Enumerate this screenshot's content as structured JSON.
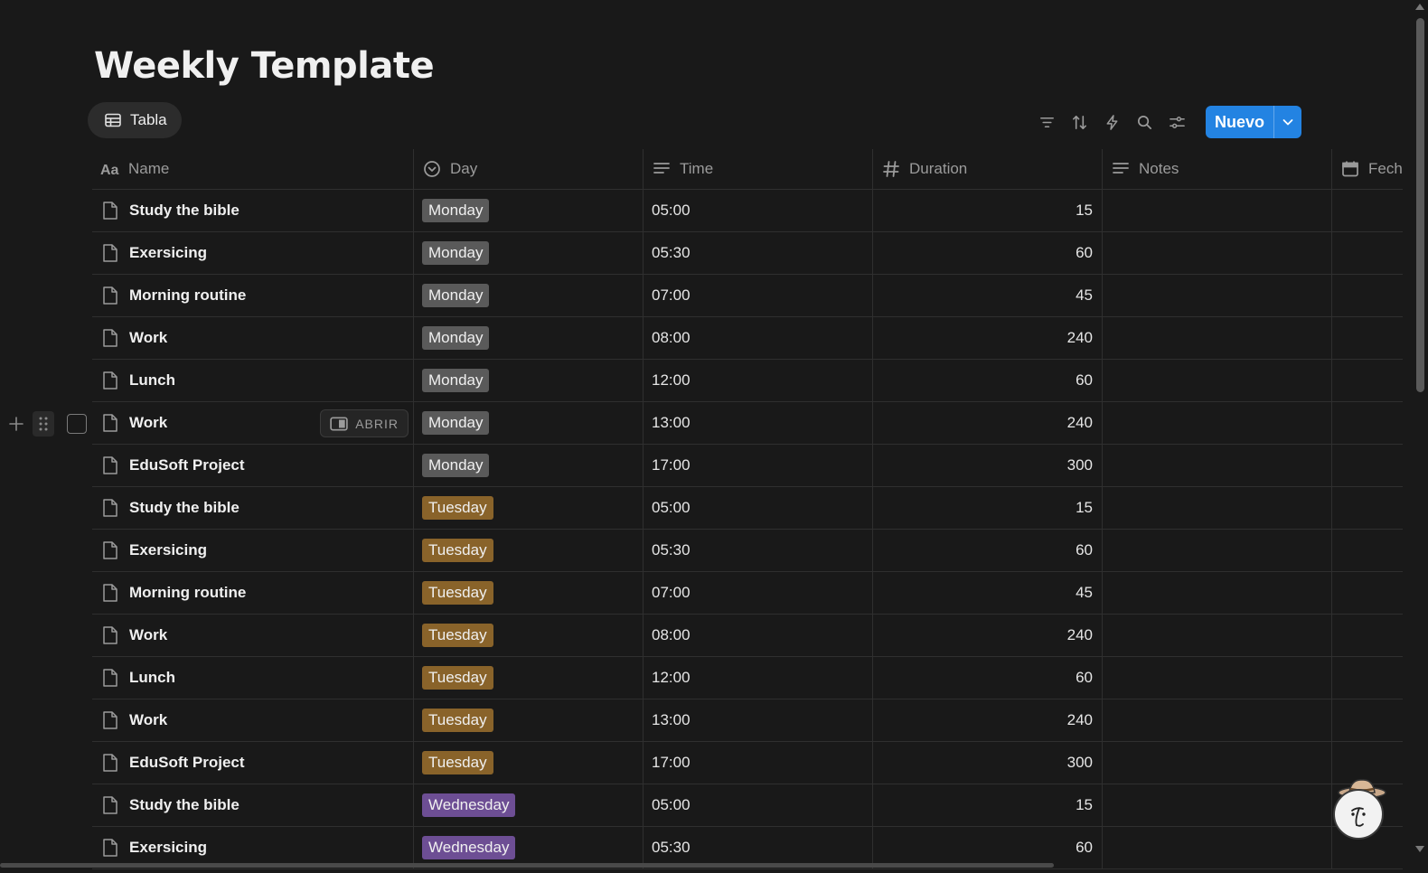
{
  "page": {
    "title": "Weekly Template"
  },
  "view_tab": {
    "label": "Tabla",
    "icon": "table-icon"
  },
  "toolbar": {
    "icons": [
      "filter-icon",
      "sort-icon",
      "automation-icon",
      "search-icon",
      "settings-icon"
    ],
    "new_label": "Nuevo"
  },
  "columns": [
    {
      "label": "Name",
      "icon": "title-icon"
    },
    {
      "label": "Day",
      "icon": "status-icon"
    },
    {
      "label": "Time",
      "icon": "text-icon"
    },
    {
      "label": "Duration",
      "icon": "number-icon"
    },
    {
      "label": "Notes",
      "icon": "text-icon"
    },
    {
      "label": "Fech",
      "icon": "calendar-icon"
    }
  ],
  "open_label": "ABRIR",
  "colors": {
    "Monday": "#5a5a5a",
    "Tuesday": "#89632a",
    "Wednesday": "#6d4e94",
    "accent": "#2383e2"
  },
  "rows": [
    {
      "name": "Study the bible",
      "day": "Monday",
      "time": "05:00",
      "duration": "15"
    },
    {
      "name": "Exersicing",
      "day": "Monday",
      "time": "05:30",
      "duration": "60"
    },
    {
      "name": "Morning routine",
      "day": "Monday",
      "time": "07:00",
      "duration": "45"
    },
    {
      "name": "Work",
      "day": "Monday",
      "time": "08:00",
      "duration": "240"
    },
    {
      "name": "Lunch",
      "day": "Monday",
      "time": "12:00",
      "duration": "60"
    },
    {
      "name": "Work",
      "day": "Monday",
      "time": "13:00",
      "duration": "240",
      "hovered": true
    },
    {
      "name": "EduSoft Project",
      "day": "Monday",
      "time": "17:00",
      "duration": "300"
    },
    {
      "name": "Study the bible",
      "day": "Tuesday",
      "time": "05:00",
      "duration": "15"
    },
    {
      "name": "Exersicing",
      "day": "Tuesday",
      "time": "05:30",
      "duration": "60"
    },
    {
      "name": "Morning routine",
      "day": "Tuesday",
      "time": "07:00",
      "duration": "45"
    },
    {
      "name": "Work",
      "day": "Tuesday",
      "time": "08:00",
      "duration": "240"
    },
    {
      "name": "Lunch",
      "day": "Tuesday",
      "time": "12:00",
      "duration": "60"
    },
    {
      "name": "Work",
      "day": "Tuesday",
      "time": "13:00",
      "duration": "240"
    },
    {
      "name": "EduSoft Project",
      "day": "Tuesday",
      "time": "17:00",
      "duration": "300"
    },
    {
      "name": "Study the bible",
      "day": "Wednesday",
      "time": "05:00",
      "duration": "15"
    },
    {
      "name": "Exersicing",
      "day": "Wednesday",
      "time": "05:30",
      "duration": "60"
    }
  ]
}
